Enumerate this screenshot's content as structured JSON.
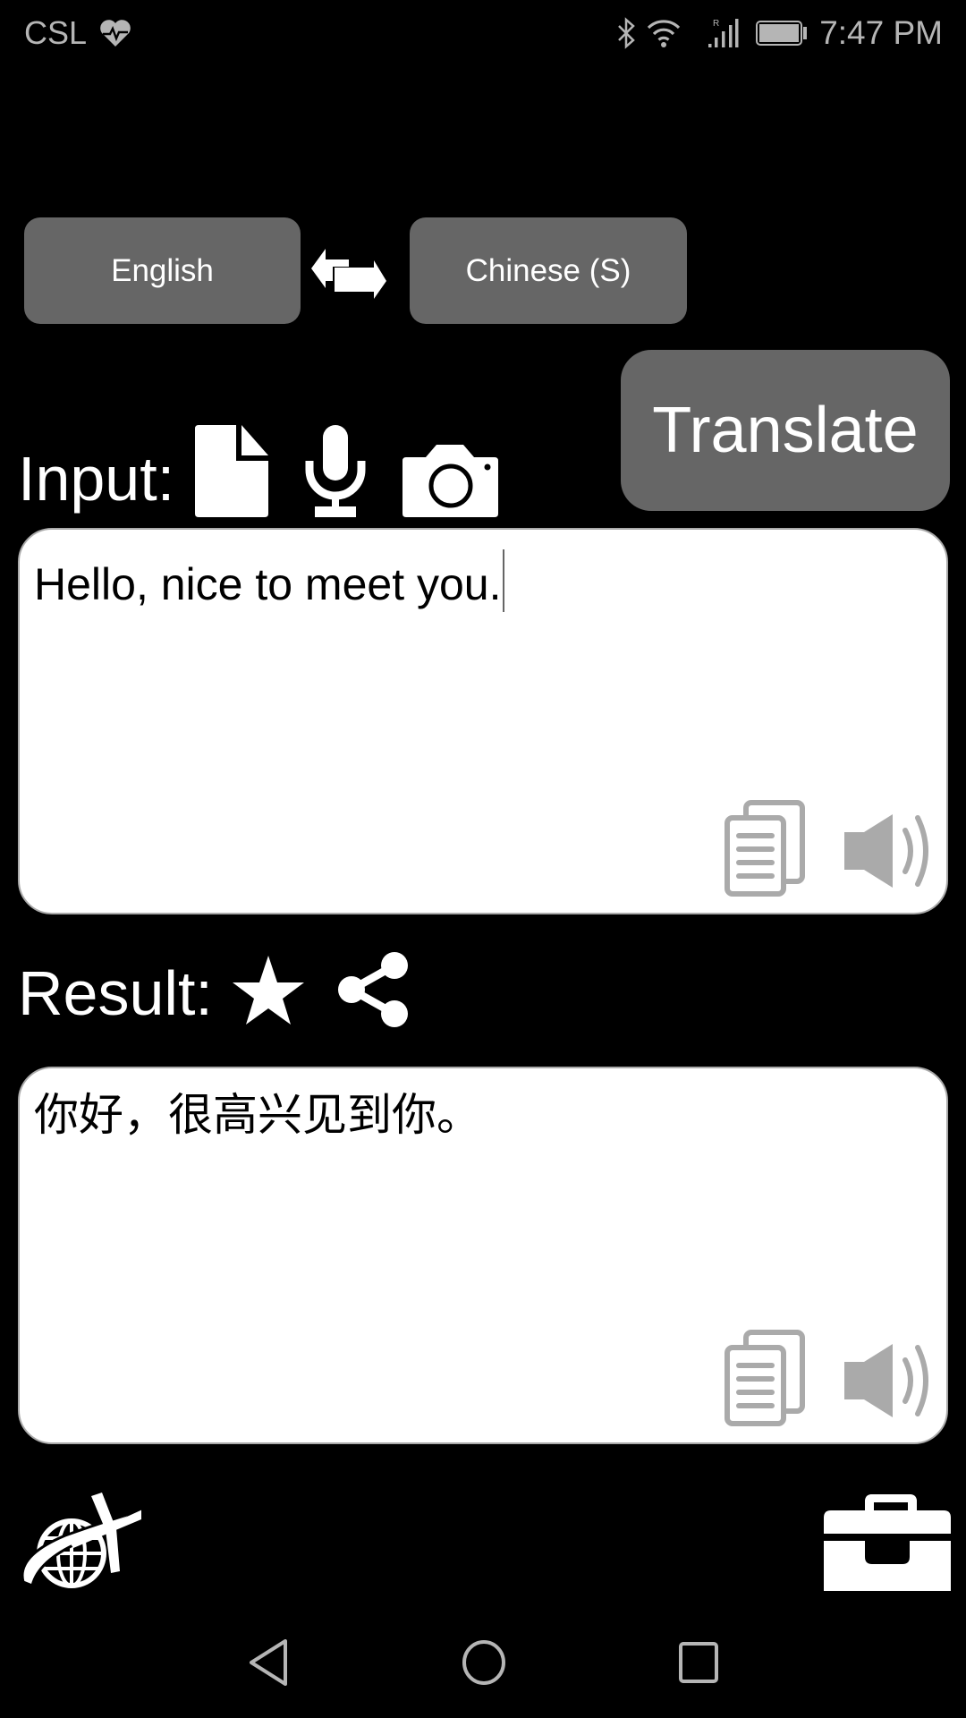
{
  "status_bar": {
    "carrier": "CSL",
    "left_icons": [
      "heart-pulse-icon"
    ],
    "right_icons": [
      "bluetooth-icon",
      "wifi-icon",
      "signal-roaming-icon",
      "battery-icon"
    ],
    "roaming_indicator": "R",
    "time": "7:47 PM"
  },
  "language_bar": {
    "source_language": "English",
    "target_language": "Chinese (S)",
    "swap_icon": "swap-arrows-icon"
  },
  "translate_button": {
    "label": "Translate"
  },
  "input_section": {
    "label": "Input:",
    "icons": [
      "file-icon",
      "microphone-icon",
      "camera-icon"
    ],
    "text": "Hello, nice to meet you.",
    "actions": [
      "copy-icon",
      "speaker-icon"
    ]
  },
  "result_section": {
    "label": "Result:",
    "icons": [
      "star-icon",
      "share-icon"
    ],
    "text": "你好，很高兴见到你。",
    "actions": [
      "copy-icon",
      "speaker-icon"
    ]
  },
  "bottom_bar": {
    "left_icon": "travel-globe-plane-icon",
    "right_icon": "toolbox-icon"
  },
  "nav_bar": {
    "buttons": [
      "back-icon",
      "home-icon",
      "recents-icon"
    ]
  },
  "colors": {
    "background": "#000000",
    "button_gray": "#666666",
    "status_gray": "#b5b5b5",
    "action_icon_gray": "#aaaaaa",
    "textbox_bg": "#ffffff"
  }
}
